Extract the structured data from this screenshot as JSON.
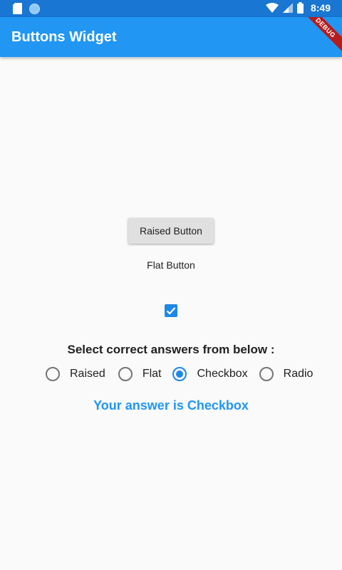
{
  "status_bar": {
    "time": "8:49"
  },
  "app_bar": {
    "title": "Buttons Widget",
    "debug_banner": "DEBUG"
  },
  "raised_button": {
    "label": "Raised Button"
  },
  "flat_button": {
    "label": "Flat Button"
  },
  "checkbox": {
    "checked": true
  },
  "prompt": "Select correct answers from below :",
  "radios": [
    {
      "label": "Raised",
      "selected": false
    },
    {
      "label": "Flat",
      "selected": false
    },
    {
      "label": "Checkbox",
      "selected": true
    },
    {
      "label": "Radio",
      "selected": false
    }
  ],
  "answer_text": "Your answer is Checkbox",
  "colors": {
    "primary": "#2196f3",
    "status_bar": "#1976d2",
    "accent": "#1e88e5"
  }
}
